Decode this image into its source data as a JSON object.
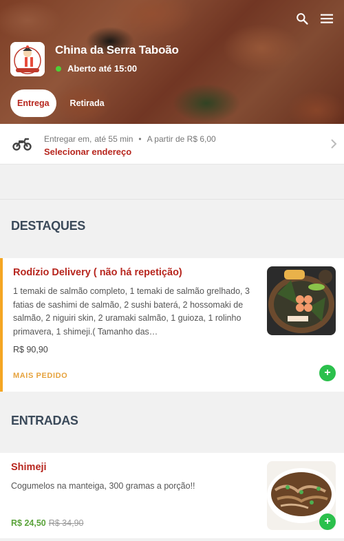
{
  "store": {
    "name": "China da Serra Taboão",
    "status": "Aberto até 15:00",
    "logo_text": "CHINA DA SERRA"
  },
  "tabs": [
    {
      "label": "Entrega",
      "active": true
    },
    {
      "label": "Retirada",
      "active": false
    }
  ],
  "delivery": {
    "label": "Entregar em,",
    "time": "até 55 min",
    "bullet": "•",
    "min_price": "A partir de R$ 6,00",
    "address_cta": "Selecionar endereço"
  },
  "sections": [
    {
      "title": "DESTAQUES",
      "items": [
        {
          "name": "Rodízio Delivery ( não há repetição)",
          "description": "1 temaki de salmão completo, 1 temaki de salmão grelhado, 3 fatias de sashimi de salmão, 2 sushi baterá, 2 hossomaki de salmão, 2 niguiri skin, 2 uramaki salmão, 1 guioza, 1 rolinho primavera, 1 shimeji.( Tamanho das…",
          "price": "R$ 90,90",
          "badge": "MAIS PEDIDO",
          "add_label": "+"
        }
      ]
    },
    {
      "title": "ENTRADAS",
      "items": [
        {
          "name": "Shimeji",
          "description": "Cogumelos na manteiga, 300 gramas a porção!!",
          "price": "R$ 24,50",
          "old_price": "R$ 34,90",
          "add_label": "+"
        }
      ]
    }
  ],
  "icons": {
    "search": "search-icon",
    "menu": "menu-icon",
    "motorcycle": "motorcycle-icon",
    "chevron": "chevron-right-icon"
  },
  "colors": {
    "brand_red": "#b7261e",
    "open_green": "#4cd137",
    "add_green": "#2bc04c",
    "badge_orange": "#e6a23c",
    "featured_border": "#f5a623"
  }
}
